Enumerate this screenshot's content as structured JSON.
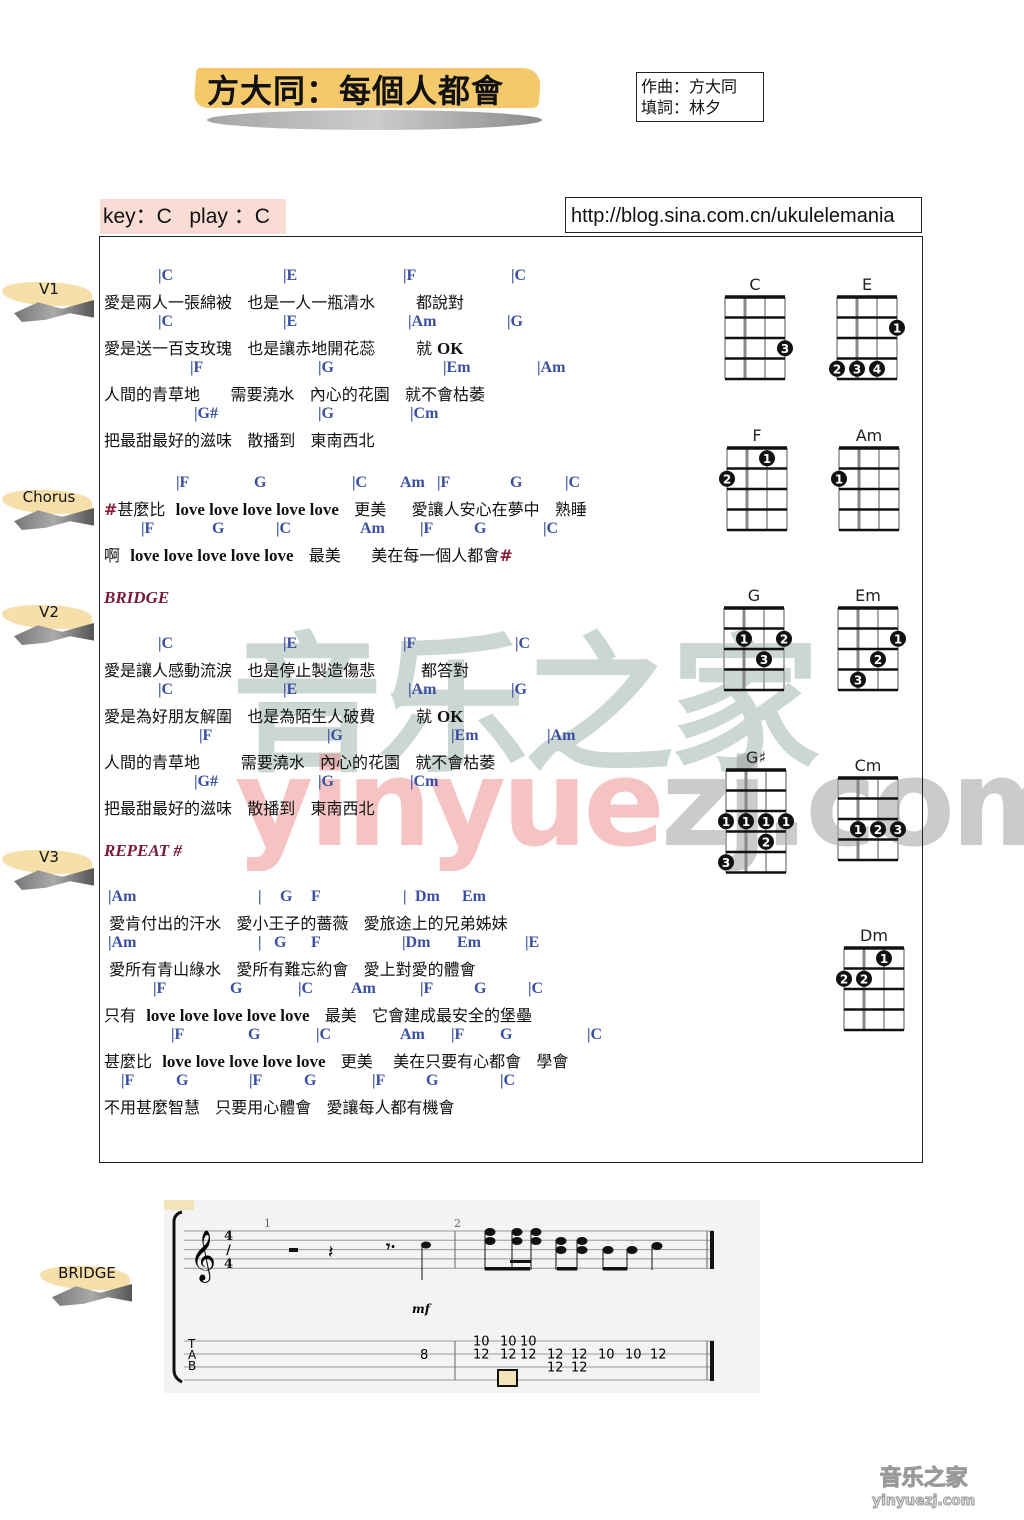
{
  "title": "方大同：每個人都會",
  "credits": {
    "composer": "作曲：方大同",
    "lyricist": "填詞：林夕"
  },
  "key_line": "key：C   play ：C",
  "url": "http://blog.sina.com.cn/ukulelemania",
  "side_labels": [
    "V1",
    "Chorus",
    "V2",
    "V3",
    "BRIDGE"
  ],
  "sections": {
    "bridge": "BRIDGE",
    "repeat": "REPEAT #"
  },
  "lines": [
    {
      "chords": [
        "|C",
        "|E",
        "|F",
        "|C"
      ],
      "lyric": [
        [
          "t",
          "愛是兩人一張綿被   也是一人一瓶清水        都說對"
        ]
      ]
    },
    {
      "chords": [
        "|C",
        "|E",
        "|Am",
        "|G"
      ],
      "lyric": [
        [
          "t",
          "愛是送一百支玫瑰   也是讓赤地開花蕊        就 "
        ],
        [
          "b",
          "OK"
        ]
      ]
    },
    {
      "chords": [
        "|F",
        "|G",
        "|Em",
        "|Am"
      ],
      "lyric": [
        [
          "t",
          "人間的青草地      需要澆水   內心的花園   就不會枯萎"
        ]
      ]
    },
    {
      "chords": [
        "|G#",
        "|G",
        "|Cm"
      ],
      "lyric": [
        [
          "t",
          "把最甜最好的滋味   散播到   東南西北"
        ]
      ]
    },
    {
      "chords": [
        "|F",
        "G",
        "|C",
        "Am",
        "|F",
        "G",
        "|C"
      ],
      "lyric": [
        [
          "m",
          "#"
        ],
        [
          "t",
          "甚麼比  "
        ],
        [
          "b",
          "love love love love love"
        ],
        [
          "t",
          "   更美     愛讓人安心在夢中   熟睡"
        ]
      ]
    },
    {
      "chords": [
        "|F",
        "G",
        "|C",
        "Am",
        "|F",
        "G",
        "|C"
      ],
      "lyric": [
        [
          "t",
          "啊  "
        ],
        [
          "b",
          "love love love love love"
        ],
        [
          "t",
          "   最美      美在每一個人都會"
        ],
        [
          "m",
          "#"
        ]
      ]
    },
    {
      "chords": [
        "|C",
        "|E",
        "|F",
        "|C"
      ],
      "lyric": [
        [
          "t",
          "愛是讓人感動流淚   也是停止製造傷悲         都答對"
        ]
      ]
    },
    {
      "chords": [
        "|C",
        "|E",
        "|Am",
        "|G"
      ],
      "lyric": [
        [
          "t",
          "愛是為好朋友解圍   也是為陌生人破費        就 "
        ],
        [
          "b",
          "OK"
        ]
      ]
    },
    {
      "chords": [
        "|F",
        "|G",
        "|Em",
        "|Am"
      ],
      "lyric": [
        [
          "t",
          "人間的青草地        需要澆水   內心的花園   就不會枯萎"
        ]
      ]
    },
    {
      "chords": [
        "|G#",
        "|G",
        "|Cm"
      ],
      "lyric": [
        [
          "t",
          "把最甜最好的滋味   散播到   東南西北"
        ]
      ]
    },
    {
      "chords": [
        "|Am",
        "|",
        "G",
        "F",
        "|",
        "Dm",
        "Em"
      ],
      "lyric": [
        [
          "t",
          " 愛肯付出的汗水   愛小王子的薔薇   愛旅途上的兄弟姊妹"
        ]
      ]
    },
    {
      "chords": [
        "|Am",
        "|",
        "G",
        "F",
        "|Dm",
        "Em",
        "|E"
      ],
      "lyric": [
        [
          "t",
          " 愛所有青山綠水   愛所有難忘約會   愛上對愛的體會"
        ]
      ]
    },
    {
      "chords": [
        "|F",
        "G",
        "|C",
        "Am",
        "|F",
        "G",
        "|C"
      ],
      "lyric": [
        [
          "t",
          "只有  "
        ],
        [
          "b",
          "love love love love love"
        ],
        [
          "t",
          "   最美   它會建成最安全的堡壘"
        ]
      ]
    },
    {
      "chords": [
        "|F",
        "G",
        "|C",
        "Am",
        "|F",
        "G",
        "|C"
      ],
      "lyric": [
        [
          "t",
          "甚麼比  "
        ],
        [
          "b",
          "love love love love love"
        ],
        [
          "t",
          "   更美    美在只要有心都會   學會"
        ]
      ]
    },
    {
      "chords": [
        "|F",
        "G",
        "|F",
        "G",
        "|F",
        "G",
        "|C"
      ],
      "lyric": [
        [
          "t",
          "不用甚麼智慧   只要用心體會   愛讓每人都有機會"
        ]
      ]
    }
  ],
  "chord_diagrams": [
    {
      "name": "C",
      "frets": 4,
      "dots": [
        [
          3,
          3,
          "3"
        ]
      ]
    },
    {
      "name": "E",
      "frets": 4,
      "dots": [
        [
          3,
          2,
          "1"
        ],
        [
          0,
          4,
          "2"
        ],
        [
          1,
          4,
          "3"
        ],
        [
          2,
          4,
          "4"
        ]
      ]
    },
    {
      "name": "F",
      "frets": 4,
      "dots": [
        [
          2,
          1,
          "1"
        ],
        [
          0,
          2,
          "2"
        ]
      ]
    },
    {
      "name": "Am",
      "frets": 4,
      "dots": [
        [
          0,
          2,
          "1"
        ]
      ]
    },
    {
      "name": "G",
      "frets": 4,
      "dots": [
        [
          1,
          2,
          "1"
        ],
        [
          3,
          2,
          "2"
        ],
        [
          2,
          3,
          "3"
        ]
      ]
    },
    {
      "name": "Em",
      "frets": 4,
      "dots": [
        [
          3,
          2,
          "1"
        ],
        [
          2,
          3,
          "2"
        ],
        [
          1,
          4,
          "3"
        ]
      ]
    },
    {
      "name": "G♯",
      "frets": 5,
      "dots": [
        [
          0,
          3,
          "1"
        ],
        [
          1,
          3,
          "1"
        ],
        [
          2,
          3,
          "1"
        ],
        [
          3,
          3,
          "1"
        ],
        [
          2,
          4,
          "2"
        ],
        [
          0,
          5,
          "3"
        ]
      ]
    },
    {
      "name": "Cm",
      "frets": 4,
      "dots": [
        [
          1,
          3,
          "1"
        ],
        [
          2,
          3,
          "2"
        ],
        [
          3,
          3,
          "3"
        ]
      ]
    },
    {
      "name": "Dm",
      "frets": 4,
      "dots": [
        [
          2,
          1,
          "1"
        ],
        [
          0,
          2,
          "2"
        ],
        [
          1,
          2,
          "2"
        ]
      ]
    }
  ],
  "tab": {
    "time_signature": "4/4",
    "measure_numbers": [
      "1",
      "2"
    ],
    "dynamic": "mf",
    "tab_letters": [
      "T",
      "A",
      "B"
    ],
    "measure1_numbers": [
      {
        "string": 2,
        "fret": "8"
      }
    ],
    "measure2_columns": [
      {
        "frets": [
          [
            "1",
            "10"
          ],
          [
            "2",
            "12"
          ]
        ]
      },
      {
        "frets": [
          [
            "1",
            "10"
          ],
          [
            "2",
            "12"
          ]
        ]
      },
      {
        "frets": [
          [
            "1",
            "10"
          ],
          [
            "2",
            "12"
          ]
        ]
      },
      {
        "frets": [
          [
            "2",
            "12"
          ],
          [
            "3",
            "12"
          ]
        ]
      },
      {
        "frets": [
          [
            "2",
            "12"
          ],
          [
            "3",
            "12"
          ]
        ]
      },
      {
        "frets": [
          [
            "2",
            "10"
          ]
        ]
      },
      {
        "frets": [
          [
            "2",
            "10"
          ]
        ]
      },
      {
        "frets": [
          [
            "2",
            "12"
          ]
        ]
      }
    ]
  },
  "watermark": {
    "cn": "音乐之家",
    "en_pink": "yinyue",
    "en_gray": "zj.com"
  },
  "logo": {
    "cn": "音乐之家",
    "en": "yinyuezj.com"
  }
}
